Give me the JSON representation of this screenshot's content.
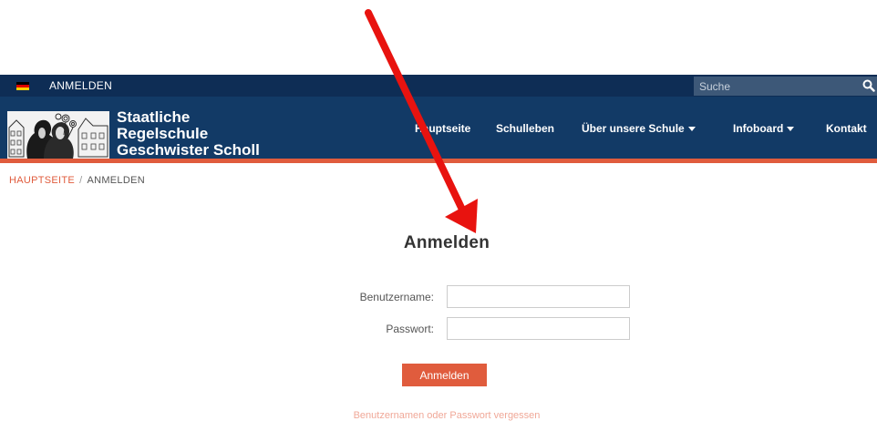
{
  "topbar": {
    "login_label": "ANMELDEN",
    "search_placeholder": "Suche",
    "flag_colors": [
      "#000000",
      "#dd0000",
      "#ffce00"
    ]
  },
  "header": {
    "school_name": [
      "Staatliche",
      "Regelschule",
      "Geschwister Scholl"
    ],
    "nav": [
      {
        "label": "Hauptseite",
        "dropdown": false
      },
      {
        "label": "Schulleben",
        "dropdown": false
      },
      {
        "label": "Über unsere Schule",
        "dropdown": true
      },
      {
        "label": "Infoboard",
        "dropdown": true
      },
      {
        "label": "Kontakt",
        "dropdown": false
      }
    ]
  },
  "breadcrumb": {
    "home": "HAUPTSEITE",
    "separator": "/",
    "current": "ANMELDEN"
  },
  "form": {
    "title": "Anmelden",
    "username_label": "Benutzername:",
    "username_value": "",
    "password_label": "Passwort:",
    "password_value": "",
    "submit_label": "Anmelden",
    "forgot_label": "Benutzernamen oder Passwort vergessen"
  },
  "colors": {
    "topbar": "#0e2d55",
    "header": "#123a66",
    "accent": "#e05c3d",
    "annotation_arrow": "#e8130f"
  },
  "icons": {
    "search": "search-icon",
    "flag": "german-flag-icon",
    "caret": "caret-down-icon",
    "annotation": "red-arrow-annotation"
  }
}
